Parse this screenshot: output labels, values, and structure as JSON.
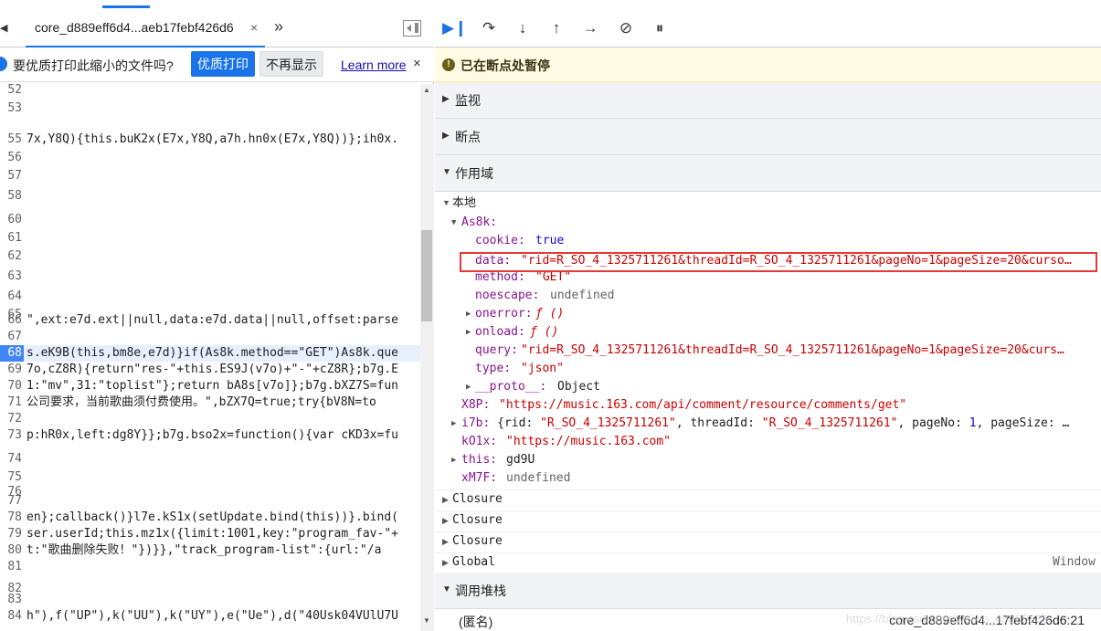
{
  "left": {
    "tab_label": "core_d889eff6d4...aeb17febf426d6",
    "tab_close": "×",
    "more_tabs": "»",
    "info_text": "要优质打印此缩小的文件吗?",
    "print_button": "优质打印",
    "dismiss_button": "不再显示",
    "learn_more": "Learn more",
    "infobar_close": "×",
    "code_lines": [
      {
        "ln": "52",
        "src": ""
      },
      {
        "ln": "53",
        "src": ""
      },
      {
        "ln": "55",
        "src": "7x,Y8Q){this.buK2x(E7x,Y8Q,a7h.hn0x(E7x,Y8Q))};ih0x."
      },
      {
        "ln": "56",
        "src": ""
      },
      {
        "ln": "57",
        "src": ""
      },
      {
        "ln": "58",
        "src": ""
      },
      {
        "ln": "60",
        "src": ""
      },
      {
        "ln": "61",
        "src": ""
      },
      {
        "ln": "62",
        "src": ""
      },
      {
        "ln": "63",
        "src": ""
      },
      {
        "ln": "64",
        "src": ""
      },
      {
        "ln": "65",
        "src": ""
      },
      {
        "ln": "66",
        "src": "\",ext:e7d.ext||null,data:e7d.data||null,offset:parse"
      },
      {
        "ln": "67",
        "src": ""
      },
      {
        "ln": "68",
        "src": "s.eK9B(this,bm8e,e7d)}if(As8k.method==\"GET\")As8k.que"
      },
      {
        "ln": "69",
        "src": "7o,cZ8R){return\"res-\"+this.ES9J(v7o)+\"-\"+cZ8R};b7g.E"
      },
      {
        "ln": "70",
        "src": "1:\"mv\",31:\"toplist\"};return bA8s[v7o]};b7g.bXZ7S=fun"
      },
      {
        "ln": "71",
        "src": "公司要求，当前歌曲须付费使用。\",bZX7Q=true;try{bV8N=to"
      },
      {
        "ln": "72",
        "src": ""
      },
      {
        "ln": "73",
        "src": "p:hR0x,left:dg8Y}};b7g.bso2x=function(){var cKD3x=fu"
      },
      {
        "ln": "74",
        "src": ""
      },
      {
        "ln": "75",
        "src": ""
      },
      {
        "ln": "76",
        "src": ""
      },
      {
        "ln": "77",
        "src": ""
      },
      {
        "ln": "78",
        "src": "en};callback()}l7e.kS1x(setUpdate.bind(this))}.bind("
      },
      {
        "ln": "79",
        "src": "ser.userId;this.mz1x({limit:1001,key:\"program_fav-\"+"
      },
      {
        "ln": "80",
        "src": "t:\"歌曲删除失败！\"})}},\"track_program-list\":{url:\"/a"
      },
      {
        "ln": "81",
        "src": ""
      },
      {
        "ln": "82",
        "src": ""
      },
      {
        "ln": "83",
        "src": ""
      },
      {
        "ln": "84",
        "src": "h\"),f(\"UP\"),k(\"UU\"),k(\"UY\"),e(\"Ue\"),d(\"40Usk04VUlU7U"
      }
    ]
  },
  "right": {
    "paused_text": "已在断点处暂停",
    "sections": {
      "watch": "监视",
      "breakpoints": "断点",
      "scope": "作用域",
      "callstack": "调用堆栈"
    },
    "scope": {
      "local": "本地",
      "as8k": "As8k:",
      "cookie_key": "cookie:",
      "cookie_val": "true",
      "data_key": "data:",
      "data_val": "\"rid=R_SO_4_1325711261&threadId=R_SO_4_1325711261&pageNo=1&pageSize=20&curso…",
      "method_key": "method:",
      "method_val": "\"GET\"",
      "noescape_key": "noescape:",
      "noescape_val": "undefined",
      "onerror_key": "onerror:",
      "onerror_val": "ƒ ()",
      "onload_key": "onload:",
      "onload_val": "ƒ ()",
      "query_key": "query:",
      "query_val": "\"rid=R_SO_4_1325711261&threadId=R_SO_4_1325711261&pageNo=1&pageSize=20&curs…",
      "type_key": "type:",
      "type_val": "\"json\"",
      "proto_key": "__proto__:",
      "proto_val": "Object",
      "x8p_key": "X8P:",
      "x8p_val": "\"https://music.163.com/api/comment/resource/comments/get\"",
      "i7b_key": "i7b:",
      "i7b_val_1": "{rid: ",
      "i7b_val_2": "\"R_SO_4_1325711261\"",
      "i7b_val_3": ", threadId: ",
      "i7b_val_4": "\"R_SO_4_1325711261\"",
      "i7b_val_5": ", pageNo: ",
      "i7b_val_6": "1",
      "i7b_val_7": ", pageSize: …",
      "k01x_key": "kO1x:",
      "k01x_val": "\"https://music.163.com\"",
      "this_key": "this:",
      "this_val": "gd9U",
      "xm7f_key": "xM7F:",
      "xm7f_val": "undefined",
      "closure_1": "Closure",
      "closure_2": "Closure",
      "closure_3": "Closure",
      "global": "Global",
      "global_val": "Window"
    },
    "callstack": {
      "fn": "(匿名)",
      "location": "core_d889eff6d4...17febf426d6:21"
    },
    "watermark": "https://blog.csdn.net/weixin_43065335"
  },
  "colors": {
    "accent": "#1a73e8",
    "paused_bg": "#fffbe5",
    "highlight": "#e53935",
    "prop_key": "#881391",
    "string": "#c80000"
  }
}
